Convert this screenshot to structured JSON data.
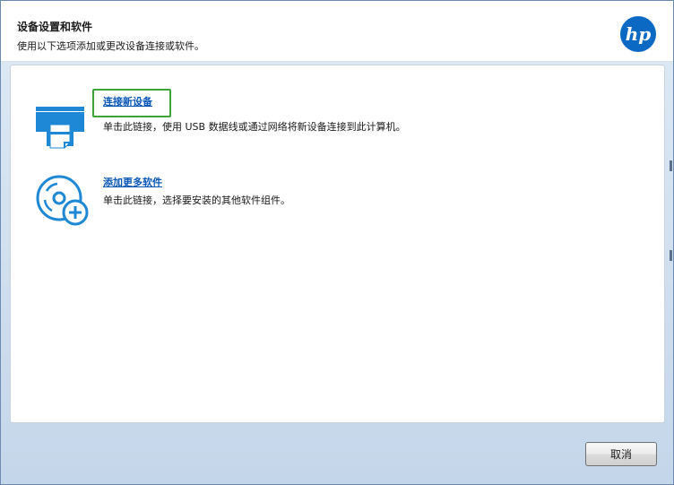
{
  "header": {
    "title": "设备设置和软件",
    "subtitle": "使用以下选项添加或更改设备连接或软件。",
    "logo_text": "hp"
  },
  "options": [
    {
      "link": "连接新设备",
      "description": "单击此链接，使用 USB 数据线或通过网络将新设备连接到此计算机。",
      "icon": "printer-connect-icon",
      "focused": true
    },
    {
      "link": "添加更多软件",
      "description": "单击此链接，选择要安装的其他软件组件。",
      "icon": "disc-add-icon",
      "focused": false
    }
  ],
  "footer": {
    "cancel_label": "取消"
  },
  "colors": {
    "accent": "#0a57b6",
    "icon_blue": "#1e88d6",
    "focus_green": "#3ca53a",
    "hp_blue": "#0b69c4"
  }
}
